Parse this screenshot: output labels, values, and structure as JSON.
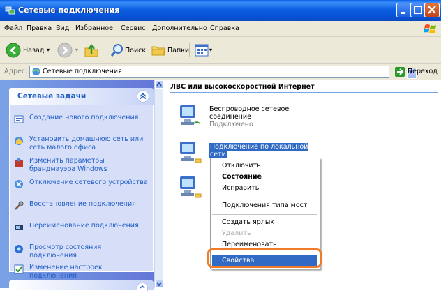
{
  "window": {
    "title": "Сетевые подключения"
  },
  "menu": [
    "Файл",
    "Правка",
    "Вид",
    "Избранное",
    "Сервис",
    "Дополнительно",
    "Справка"
  ],
  "toolbar": {
    "back_label": "Назад",
    "search_label": "Поиск",
    "folders_label": "Папки"
  },
  "address": {
    "label": "Адрес:",
    "value": "Сетевые подключения",
    "go_label": "Переход"
  },
  "taskpane": {
    "title": "Сетевые задачи",
    "tasks": [
      {
        "label": "Создание нового подключения",
        "icon": "new-connection-icon"
      },
      {
        "label": "Установить домашнюю сеть или сеть малого офиса",
        "icon": "home-network-icon"
      },
      {
        "label": "Изменить параметры брандмауэра Windows",
        "icon": "firewall-icon"
      },
      {
        "label": "Отключение сетевого устройства",
        "icon": "disable-device-icon"
      },
      {
        "label": "Восстановление подключения",
        "icon": "repair-icon"
      },
      {
        "label": "Переименование подключения",
        "icon": "rename-icon"
      },
      {
        "label": "Просмотр состояния подключения",
        "icon": "status-icon"
      },
      {
        "label": "Изменение настроек подключения",
        "icon": "settings-icon"
      }
    ]
  },
  "main": {
    "group_title": "ЛВС или высокоскоростной Интернет",
    "connections": [
      {
        "name_line1": "Беспроводное сетевое",
        "name_line2": "соединение",
        "status": "Подключено"
      },
      {
        "name_line1": "Подключение по локальной",
        "name_line2": "сети"
      }
    ]
  },
  "context_menu": {
    "items": [
      "Отключить",
      "Состояние",
      "Исправить",
      "Подключения типа мост",
      "Создать ярлык",
      "Удалить",
      "Переименовать",
      "Свойства"
    ]
  },
  "colors": {
    "titlebar": "#0752d6",
    "highlight": "#316ac5",
    "accent_ring": "#f07b28",
    "task_link": "#215dc6"
  }
}
